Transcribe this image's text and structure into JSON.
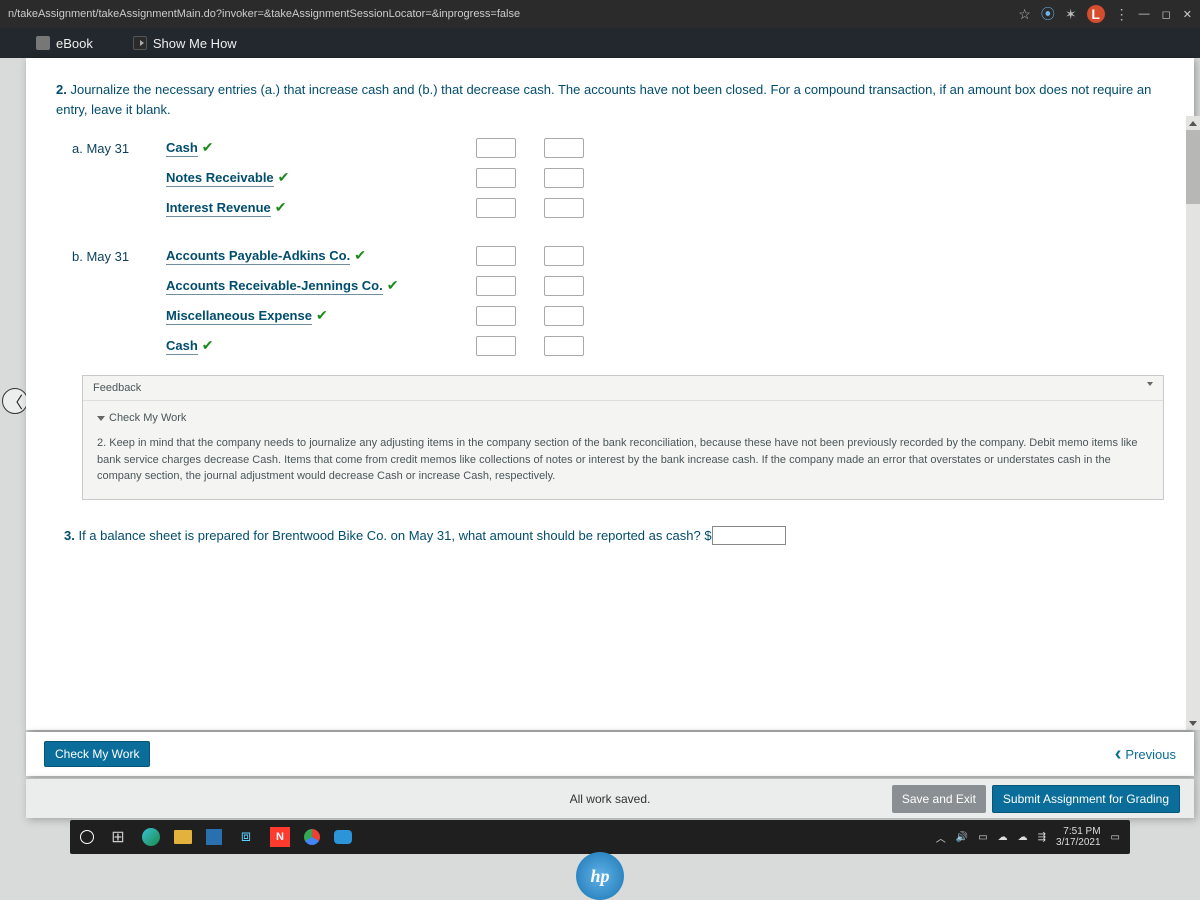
{
  "browser": {
    "url": "n/takeAssignment/takeAssignmentMain.do?invoker=&takeAssignmentSessionLocator=&inprogress=false",
    "profile_letter": "L"
  },
  "subnav": {
    "ebook": "eBook",
    "show_me_how": "Show Me How"
  },
  "q2": {
    "number": "2.",
    "text": "Journalize the necessary entries (a.) that increase cash and (b.) that decrease cash. The accounts have not been closed. For a compound transaction, if an amount box does not require an entry, leave it blank.",
    "a_label": "a. May 31",
    "b_label": "b. May 31",
    "accounts_a": [
      "Cash",
      "Notes Receivable",
      "Interest Revenue"
    ],
    "accounts_b": [
      "Accounts Payable-Adkins Co.",
      "Accounts Receivable-Jennings Co.",
      "Miscellaneous Expense",
      "Cash"
    ]
  },
  "feedback": {
    "header": "Feedback",
    "cmw_label": "Check My Work",
    "body": "2. Keep in mind that the company needs to journalize any adjusting items in the company section of the bank reconciliation, because these have not been previously recorded by the company. Debit memo items like bank service charges decrease Cash. Items that come from credit memos like collections of notes or interest by the bank increase cash. If the company made an error that overstates or understates cash in the company section, the journal adjustment would decrease Cash or increase Cash, respectively."
  },
  "q3": {
    "number": "3.",
    "text": "If a balance sheet is prepared for Brentwood Bike Co. on May 31, what amount should be reported as cash?",
    "currency": "$"
  },
  "footer": {
    "check_my_work": "Check My Work",
    "previous": "Previous"
  },
  "save_bar": {
    "status": "All work saved.",
    "save_exit": "Save and Exit",
    "submit": "Submit Assignment for Grading"
  },
  "taskbar": {
    "time": "7:51 PM",
    "date": "3/17/2021"
  },
  "hp": "hp"
}
